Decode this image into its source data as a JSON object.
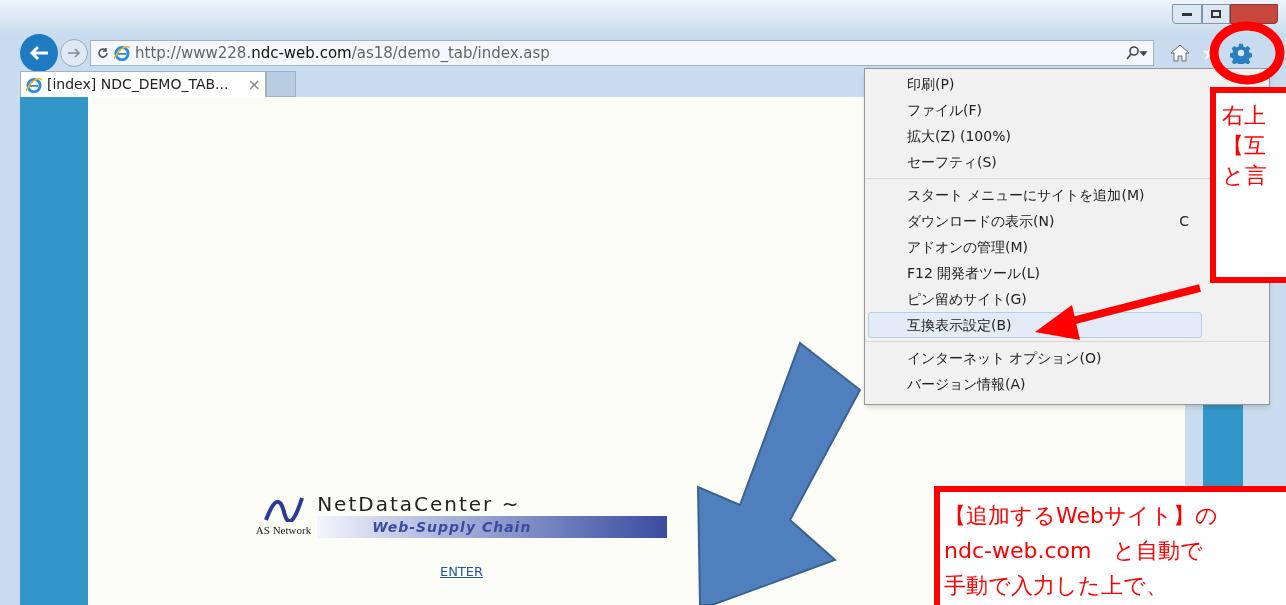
{
  "browser": {
    "address": {
      "prefix": "http://www228.",
      "domain": "ndc-web.com",
      "path": "/as18/demo_tab/index.asp"
    },
    "tabs": [
      {
        "title": "[index] NDC_DEMO_TAB...",
        "close": "×",
        "selected": true
      }
    ]
  },
  "page": {
    "logo": {
      "title": "NetDataCenter ~",
      "tagline": "Web-Supply Chain",
      "company": "AS Network"
    },
    "link": "ENTER"
  },
  "menu": {
    "groups": [
      [
        {
          "label": "印刷(P)",
          "selected": false
        },
        {
          "label": "ファイル(F)",
          "selected": false
        },
        {
          "label": "拡大(Z) (100%)",
          "selected": false
        },
        {
          "label": "セーフティ(S)",
          "selected": false
        }
      ],
      [
        {
          "label": "スタート メニューにサイトを追加(M)",
          "selected": false
        },
        {
          "label": "ダウンロードの表示(N)",
          "shortcut": "C",
          "selected": false
        },
        {
          "label": "アドオンの管理(M)",
          "selected": false
        },
        {
          "label": "F12 開発者ツール(L)",
          "selected": false
        },
        {
          "label": "ピン留めサイト(G)",
          "selected": false
        },
        {
          "label": "互換表示設定(B)",
          "selected": true
        }
      ],
      [
        {
          "label": "インターネット オプション(O)",
          "selected": false
        },
        {
          "label": "バージョン情報(A)",
          "selected": false
        }
      ]
    ]
  },
  "annotations": {
    "callout_top": [
      "右上",
      "【互",
      "と言"
    ],
    "callout_bottom": [
      "【追加するWebサイト】の",
      "ndc-web.com　と自動で",
      "手動で入力した上で、"
    ]
  }
}
